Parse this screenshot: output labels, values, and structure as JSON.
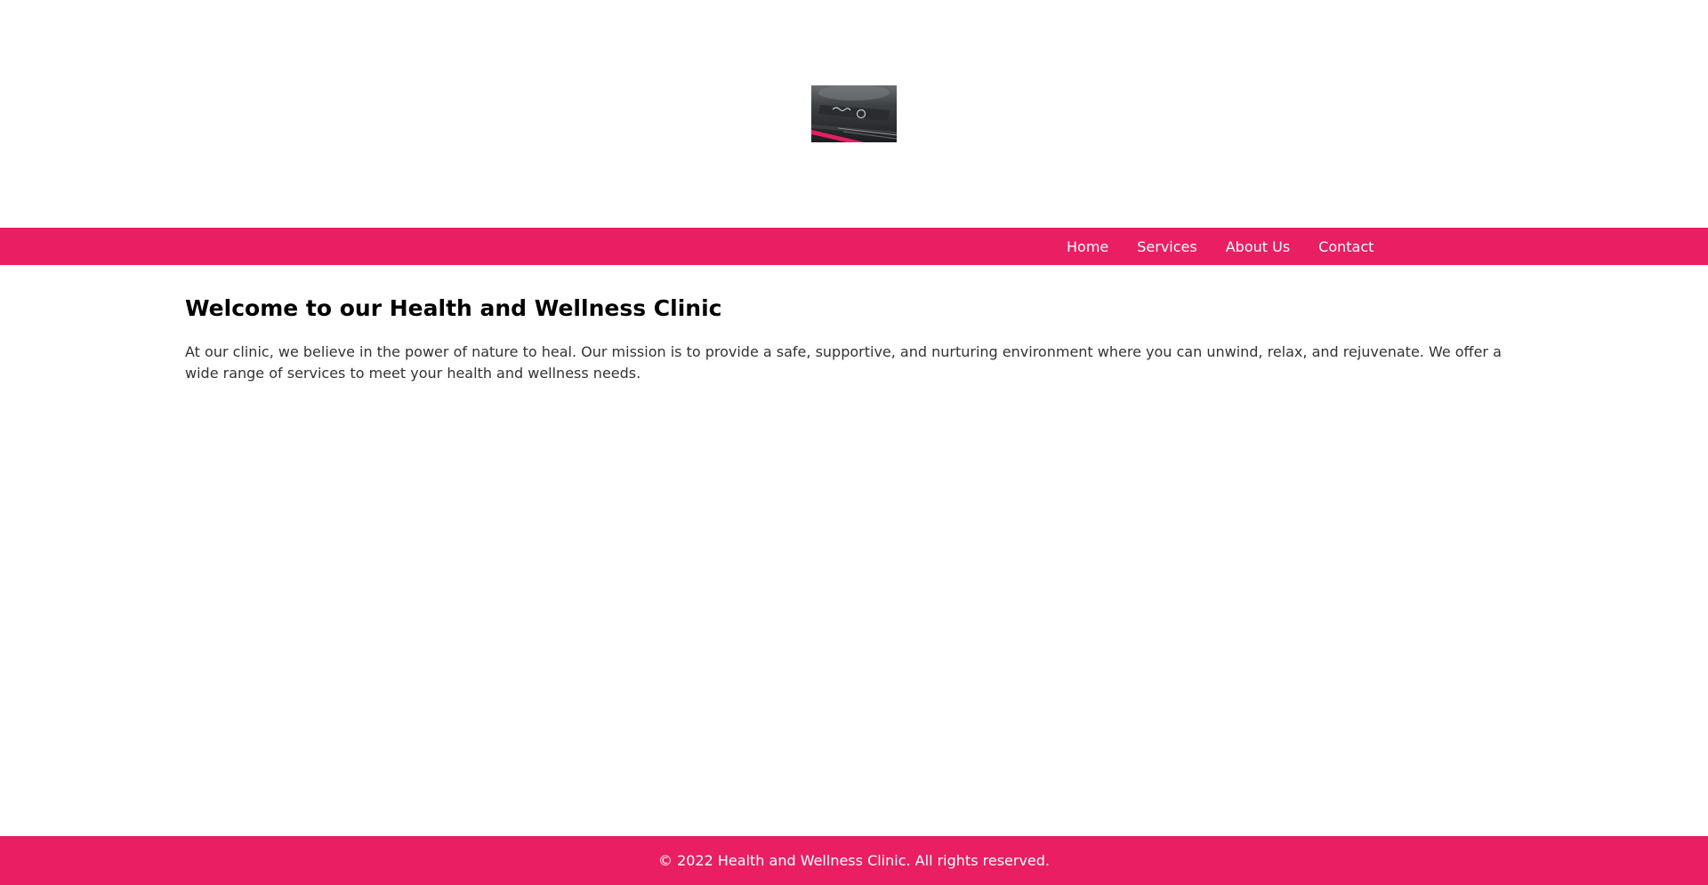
{
  "brand": {
    "logo_icon": "logo-photo-icon",
    "accent_color": "#e91e63"
  },
  "nav": {
    "items": [
      {
        "label": "Home"
      },
      {
        "label": "Services"
      },
      {
        "label": "About Us"
      },
      {
        "label": "Contact"
      }
    ]
  },
  "main": {
    "heading": "Welcome to our Health and Wellness Clinic",
    "paragraph": "At our clinic, we believe in the power of nature to heal. Our mission is to provide a safe, supportive, and nurturing environment where you can unwind, relax, and rejuvenate. We offer a wide range of services to meet your health and wellness needs."
  },
  "footer": {
    "text": "© 2022 Health and Wellness Clinic. All rights reserved."
  }
}
